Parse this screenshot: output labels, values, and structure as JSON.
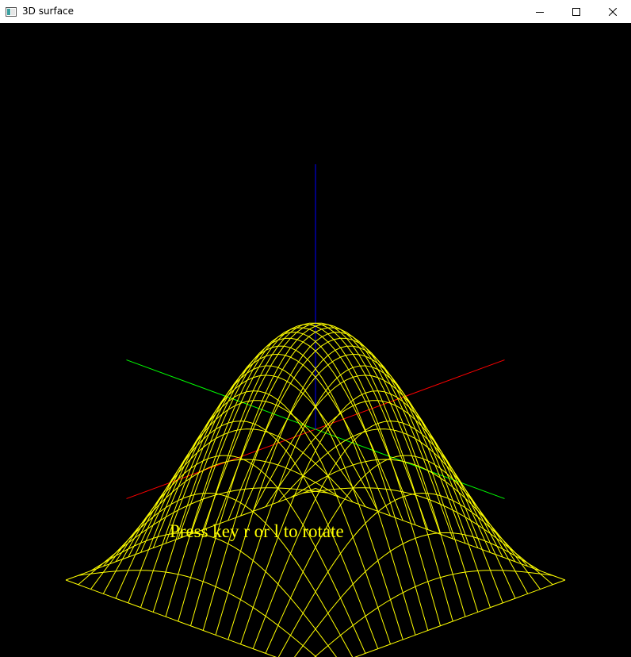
{
  "window": {
    "title": "3D surface",
    "icon": "app-window-icon",
    "controls": [
      "minimize-icon",
      "maximize-icon",
      "close-icon"
    ]
  },
  "scene": {
    "surface": "z = cos(x) * cos(y) wireframe",
    "axis_colors": {
      "x": "#ff0000",
      "y": "#00ff00",
      "z": "#0000ff"
    },
    "surface_color": "#ffff00",
    "background": "#000000"
  },
  "caption": "Press key r or l to rotate"
}
